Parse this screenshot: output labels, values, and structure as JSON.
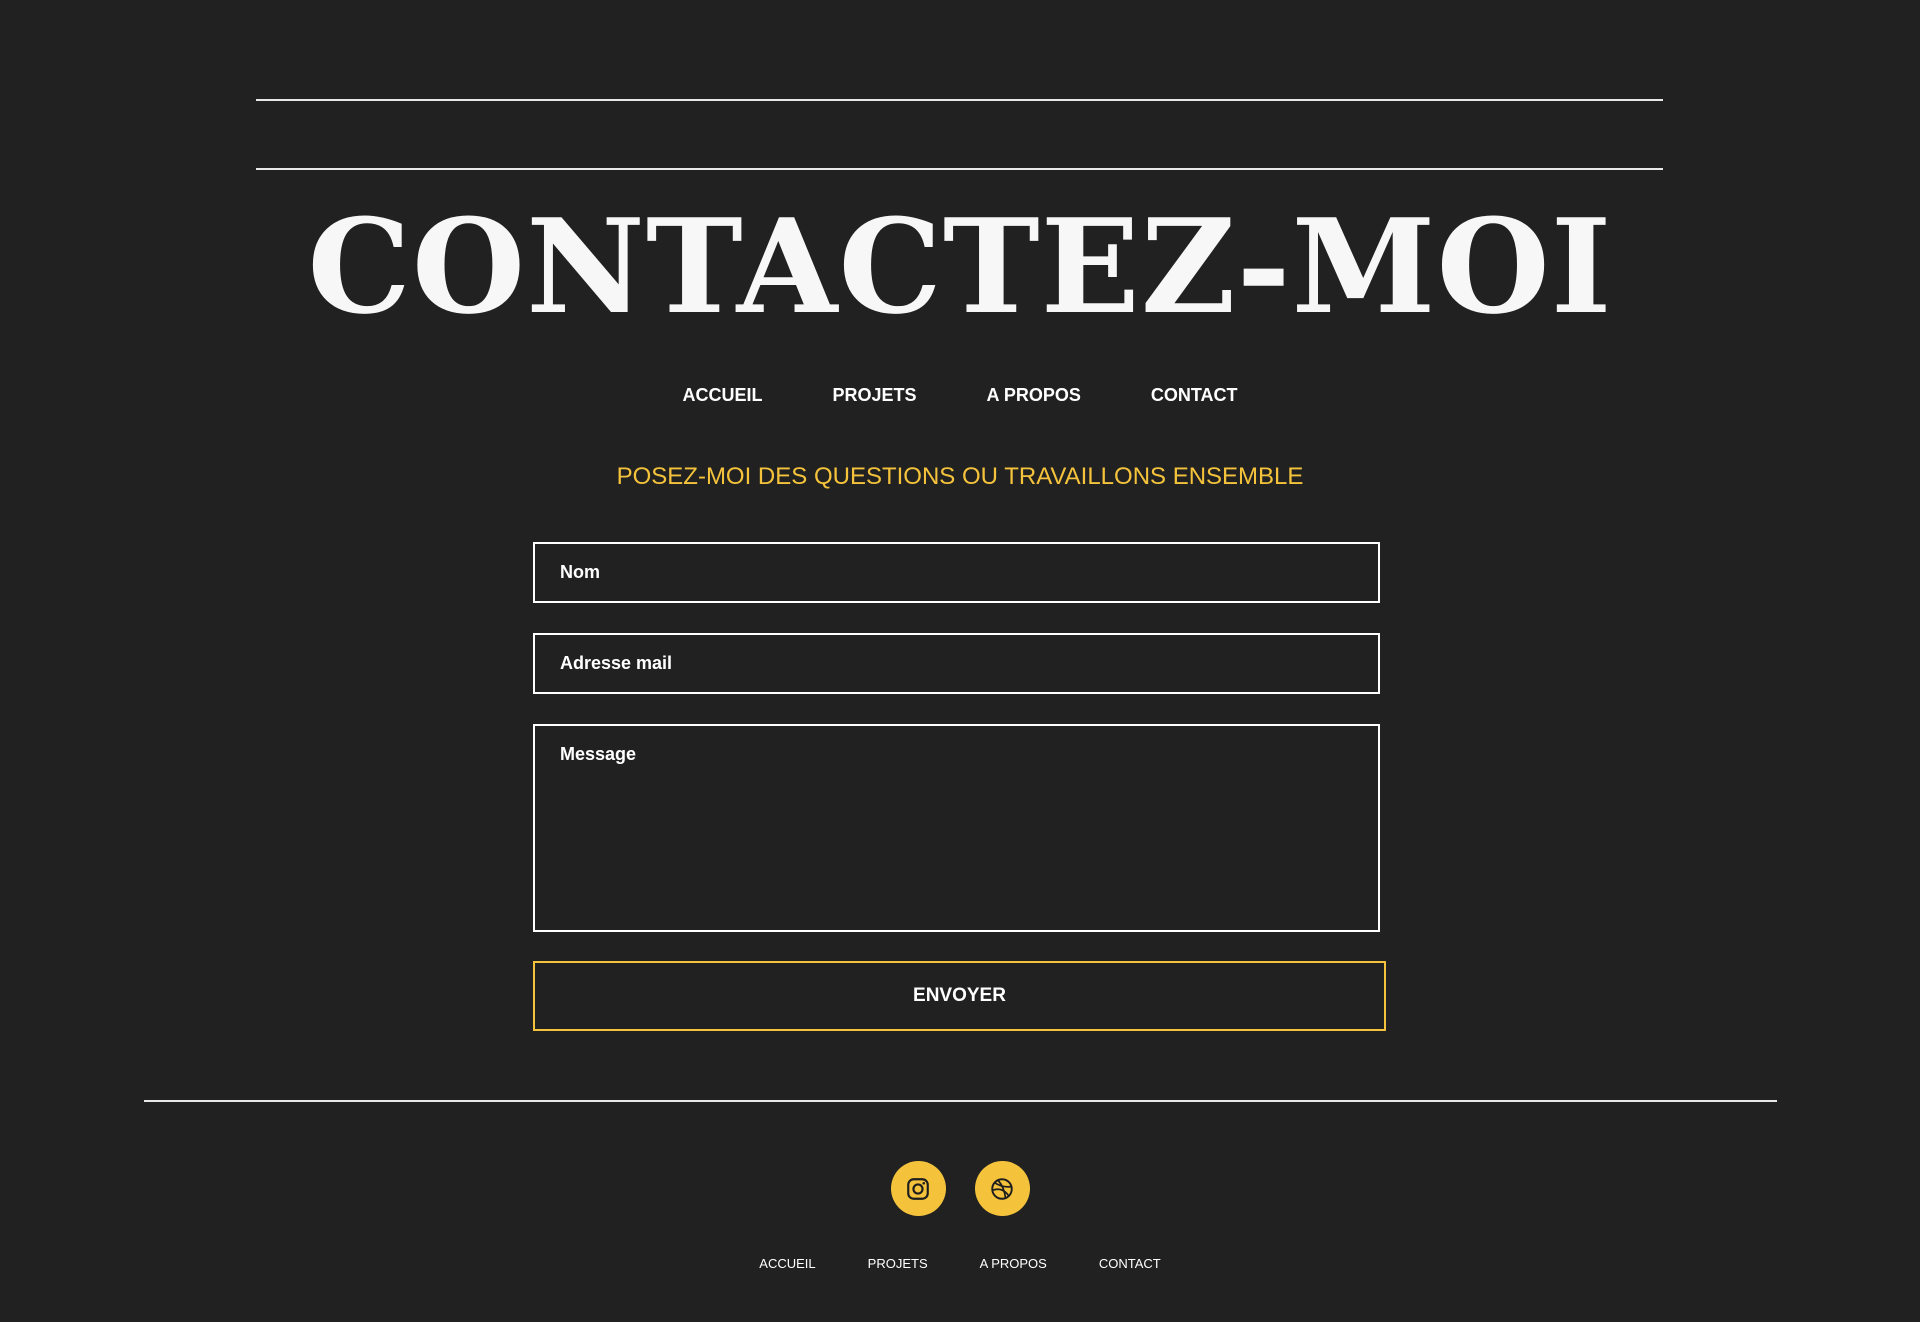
{
  "header": {
    "title": "CONTACTEZ-MOI"
  },
  "nav": {
    "items": [
      {
        "label": "ACCUEIL"
      },
      {
        "label": "PROJETS"
      },
      {
        "label": "A PROPOS"
      },
      {
        "label": "CONTACT"
      }
    ]
  },
  "form": {
    "subtitle": "POSEZ-MOI DES QUESTIONS OU TRAVAILLONS ENSEMBLE",
    "name_placeholder": "Nom",
    "email_placeholder": "Adresse mail",
    "message_placeholder": "Message",
    "submit_label": "ENVOYER"
  },
  "social": {
    "icons": [
      "instagram-icon",
      "dribbble-icon"
    ],
    "accent_color": "#f5c33b"
  },
  "footer": {
    "items": [
      {
        "label": "ACCUEIL"
      },
      {
        "label": "PROJETS"
      },
      {
        "label": "A PROPOS"
      },
      {
        "label": "CONTACT"
      }
    ]
  },
  "colors": {
    "background": "#212121",
    "accent": "#f5c33b",
    "text": "#ffffff"
  }
}
